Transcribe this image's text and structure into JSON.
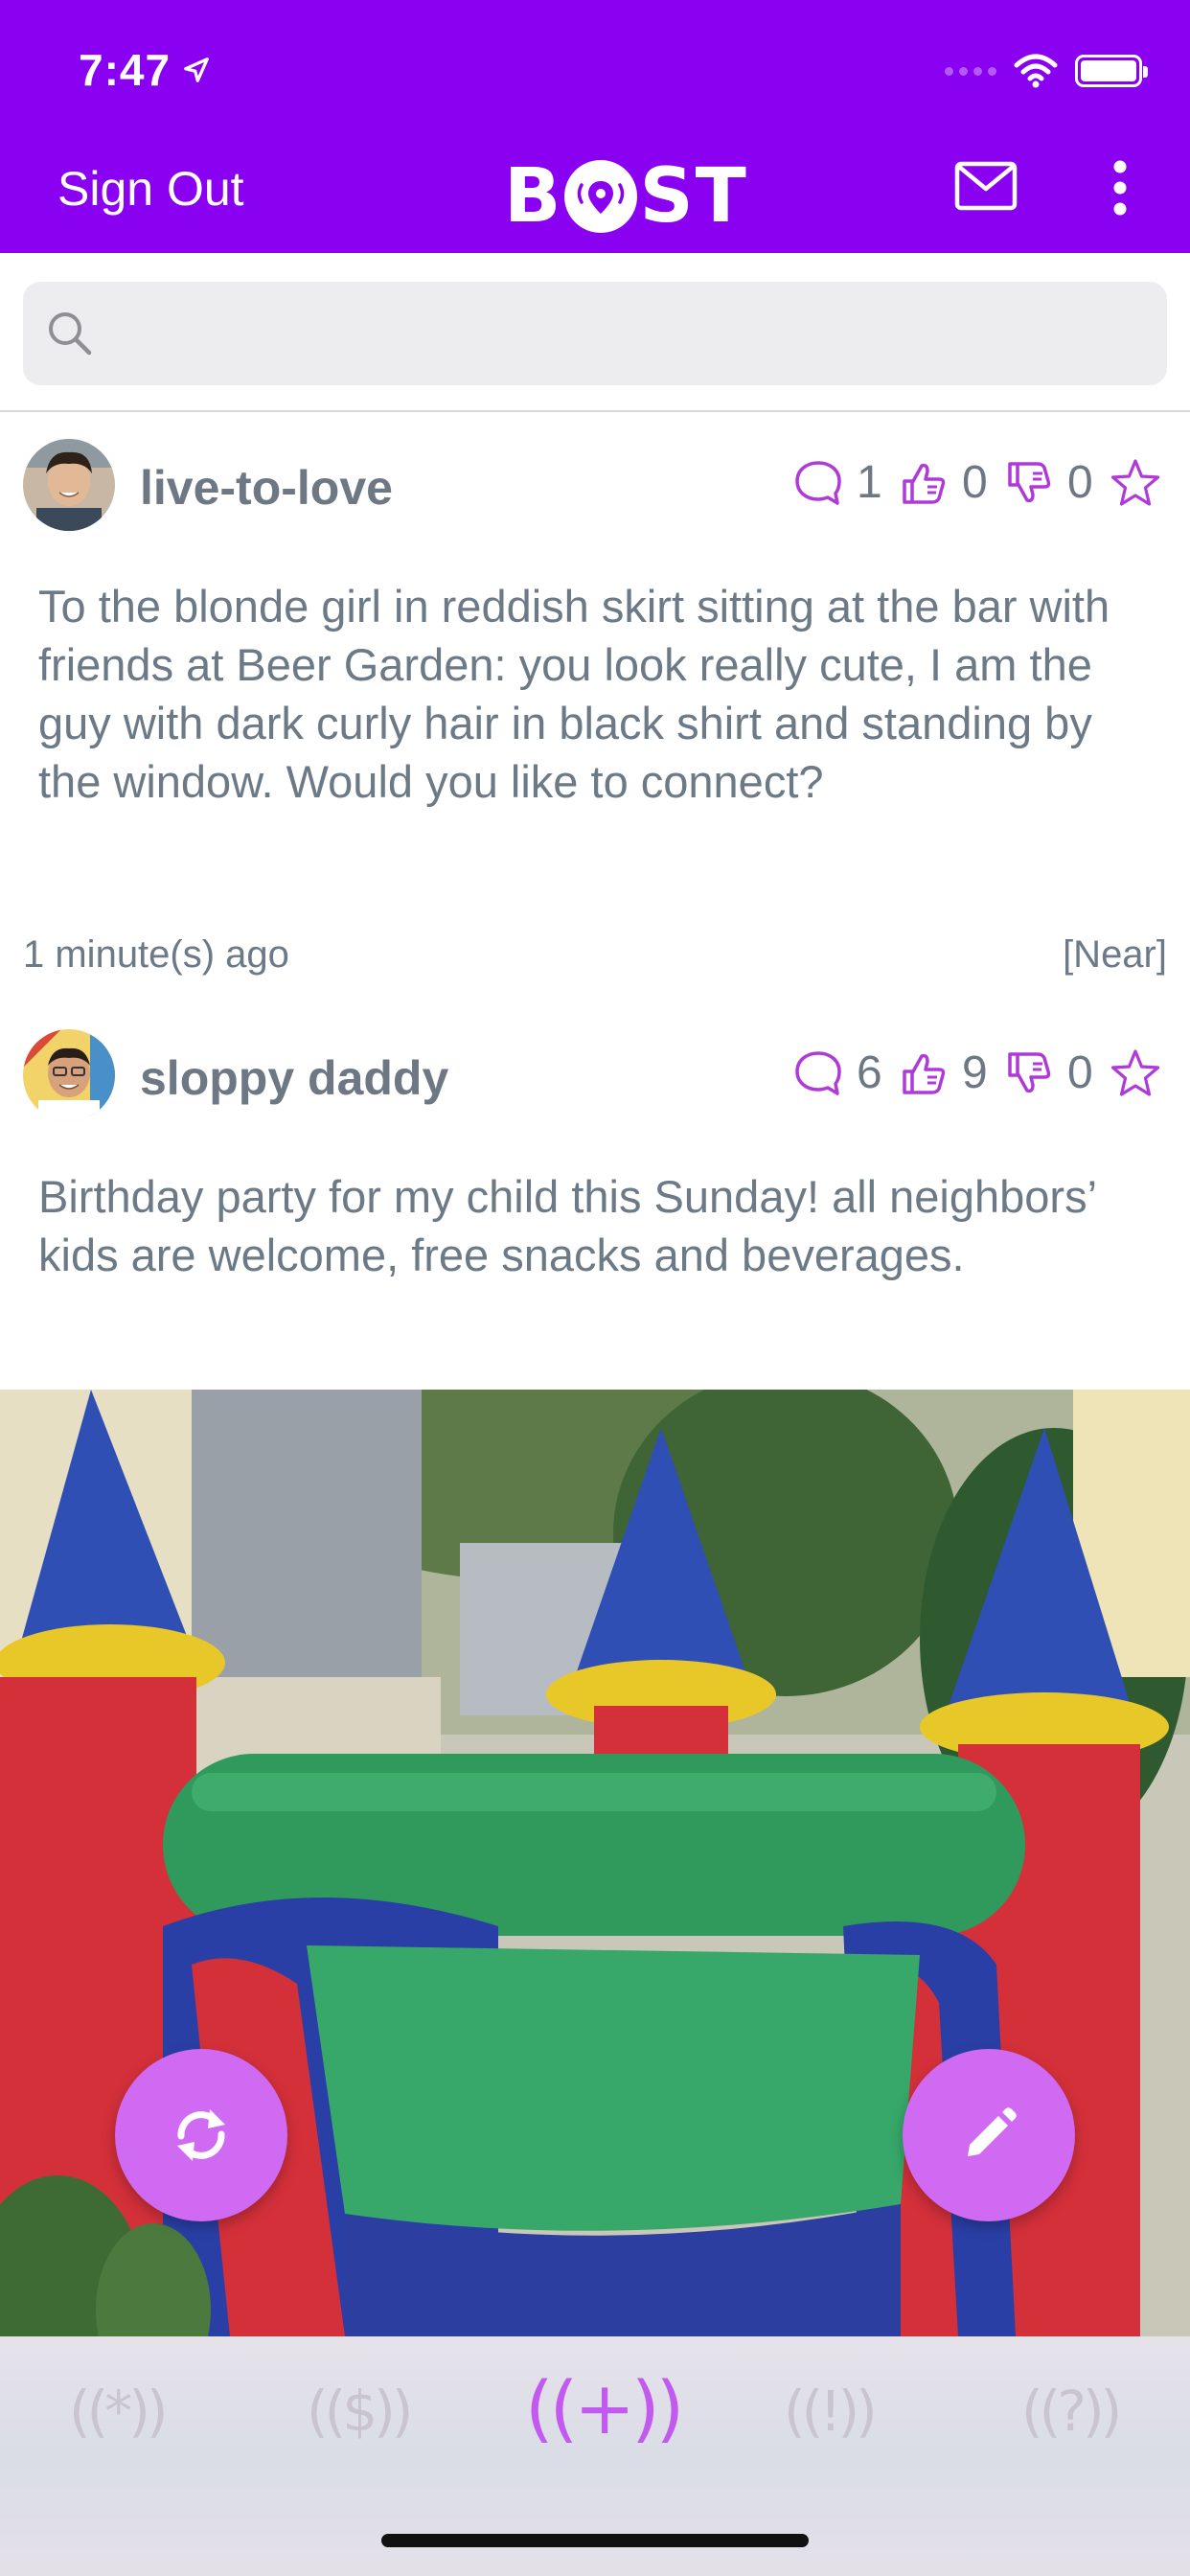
{
  "status_bar": {
    "time": "7:47"
  },
  "header": {
    "sign_out_label": "Sign Out",
    "logo_text_left": "B",
    "logo_text_right": "ST",
    "mail_icon": "mail-icon",
    "menu_icon": "more-vertical-icon"
  },
  "search": {
    "placeholder": ""
  },
  "posts": [
    {
      "username": "live-to-love",
      "comments": "1",
      "likes": "0",
      "dislikes": "0",
      "body": "To the blonde girl in reddish skirt sitting at the bar with friends at Beer Garden: you look really cute, I am the guy with dark curly hair in black shirt and standing by the window. Would you like to connect?",
      "time_ago": "1 minute(s) ago",
      "distance": "[Near]"
    },
    {
      "username": "sloppy daddy",
      "comments": "6",
      "likes": "9",
      "dislikes": "0",
      "body": "Birthday party for my child this Sunday! all neighbors’ kids are welcome, free snacks and beverages."
    }
  ],
  "fabs": {
    "refresh_icon": "refresh-icon",
    "compose_icon": "pencil-icon"
  },
  "tabs": [
    {
      "label": "((*))",
      "active": false
    },
    {
      "label": "(($))",
      "active": false
    },
    {
      "label": "((+))",
      "active": true
    },
    {
      "label": "((!))",
      "active": false
    },
    {
      "label": "((?))",
      "active": false
    }
  ],
  "colors": {
    "brand": "#8a00f0",
    "accent": "#c25af0",
    "fab": "#d06af3"
  }
}
